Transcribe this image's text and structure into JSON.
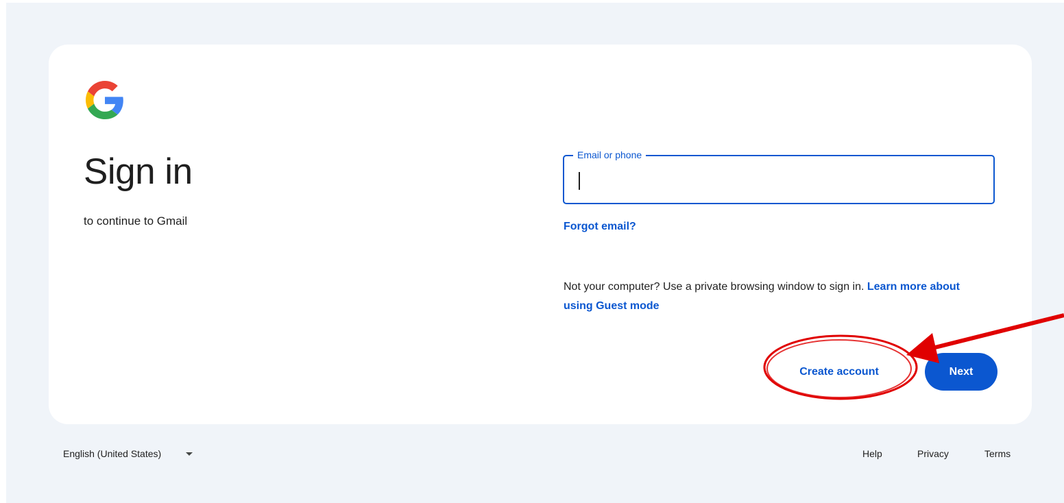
{
  "signin": {
    "title": "Sign in",
    "subtitle": "to continue to Gmail",
    "email_label": "Email or phone",
    "email_value": "",
    "forgot_email": "Forgot email?",
    "guest_text": "Not your computer? Use a private browsing window to sign in. ",
    "guest_link": "Learn more about using Guest mode",
    "create_account": "Create account",
    "next": "Next"
  },
  "footer": {
    "language": "English (United States)",
    "help": "Help",
    "privacy": "Privacy",
    "terms": "Terms"
  },
  "icons": {
    "logo": "google-logo-icon",
    "language_dropdown": "chevron-down-icon"
  },
  "colors": {
    "page_bg": "#f0f4f9",
    "card_bg": "#ffffff",
    "accent": "#0b57d0",
    "text": "#1f1f1f",
    "annotation": "#e00000"
  }
}
